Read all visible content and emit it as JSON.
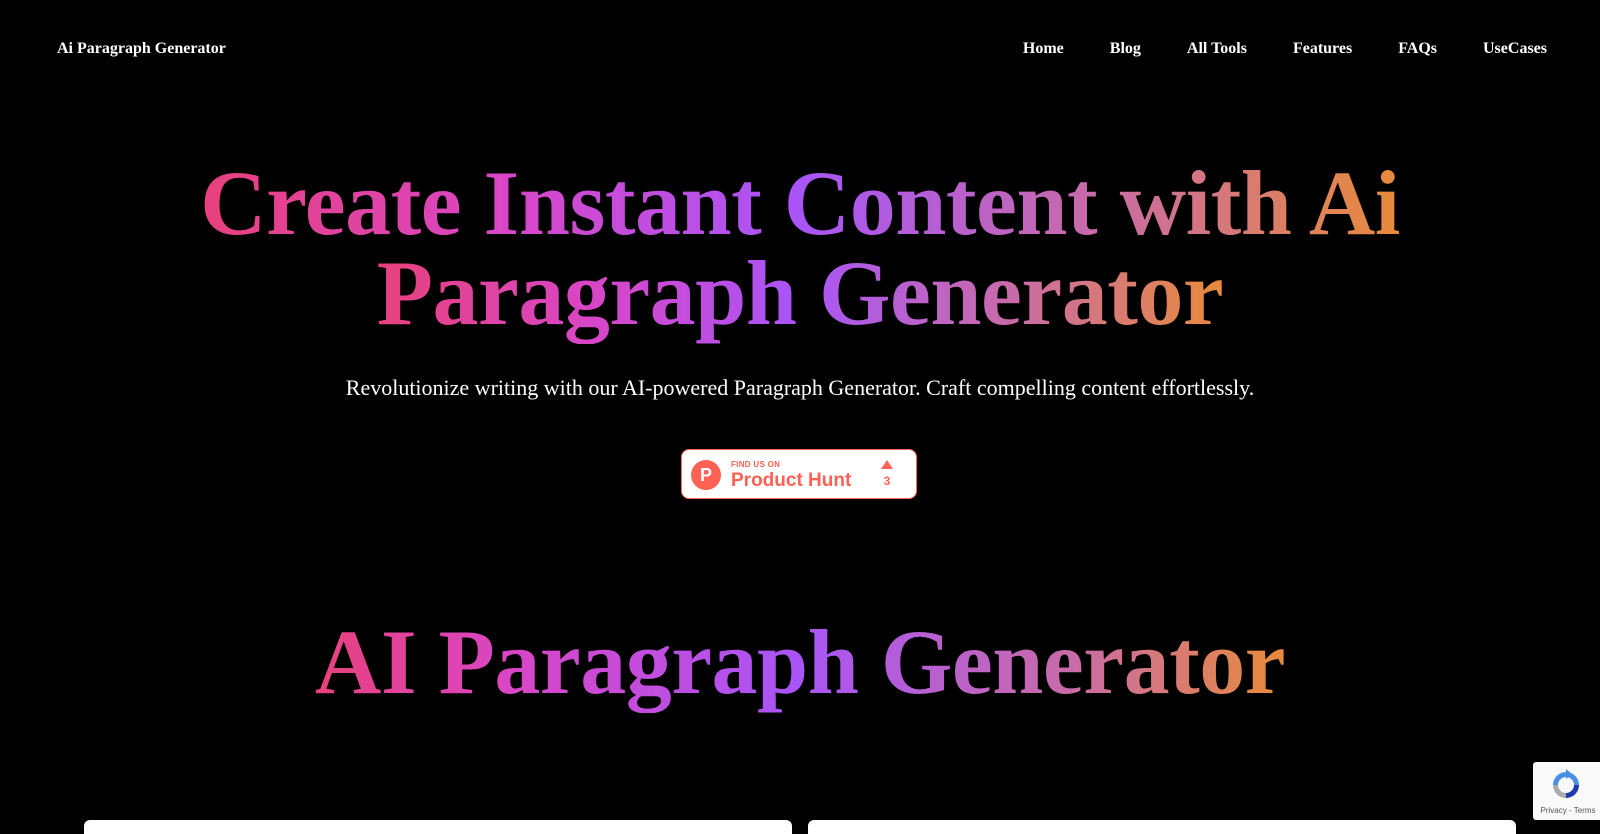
{
  "nav": {
    "brand": "Ai Paragraph Generator",
    "links": [
      "Home",
      "Blog",
      "All Tools",
      "Features",
      "FAQs",
      "UseCases"
    ]
  },
  "hero": {
    "title_line1": "Create Instant Content with Ai",
    "title_line2": "Paragraph Generator",
    "subtitle": "Revolutionize writing with our AI-powered Paragraph Generator. Craft compelling content effortlessly."
  },
  "product_hunt": {
    "kicker": "FIND US ON",
    "name": "Product Hunt",
    "logo_letter": "P",
    "upvotes": "3",
    "icon": "product-hunt-logo",
    "color": "#ff6154"
  },
  "section": {
    "title": "AI Paragraph Generator"
  },
  "recaptcha": {
    "privacy": "Privacy",
    "separator": " - ",
    "terms": "Terms"
  },
  "colors": {
    "background": "#000000",
    "gradient_start": "#e8417c",
    "gradient_mid": "#a855f7",
    "gradient_end": "#e88b3a"
  }
}
